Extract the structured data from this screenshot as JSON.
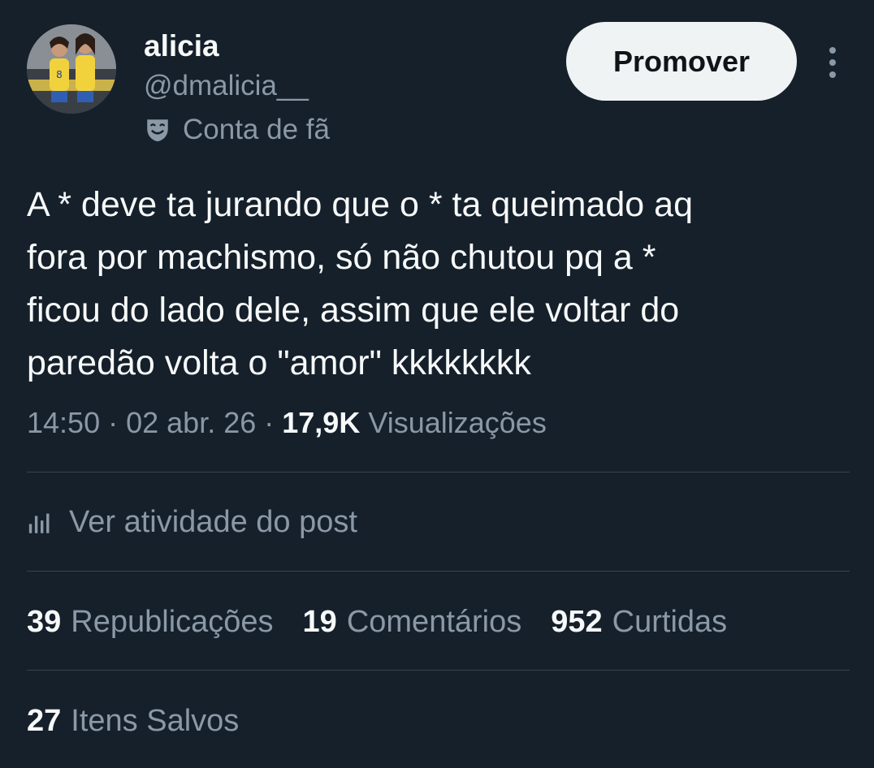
{
  "author": {
    "display_name": "alicia",
    "handle": "@dmalicia__",
    "badge_label": "Conta de fã",
    "badge_icon": "theater-masks-icon",
    "avatar": "profile-photo"
  },
  "actions": {
    "promote_label": "Promover",
    "more_icon": "more-vertical-icon"
  },
  "post": {
    "text": "A * deve ta jurando que o * ta queimado aq\nfora por machismo, só não chutou pq a *\nficou do lado dele, assim que ele voltar do\nparedão volta o \"amor\" kkkkkkkk",
    "time": "14:50",
    "date": "02 abr. 26",
    "views_count": "17,9K",
    "views_label": "Visualizações"
  },
  "activity": {
    "icon": "bar-chart-icon",
    "label": "Ver atividade do post"
  },
  "stats": {
    "reposts": {
      "count": "39",
      "label": "Republicações"
    },
    "comments": {
      "count": "19",
      "label": "Comentários"
    },
    "likes": {
      "count": "952",
      "label": "Curtidas"
    },
    "bookmarks": {
      "count": "27",
      "label": "Itens Salvos"
    }
  },
  "colors": {
    "background": "#15202b",
    "primary_text": "#f7f9f9",
    "secondary_text": "#8b98a5",
    "divider": "#38444d",
    "button_bg": "#eff3f4"
  }
}
